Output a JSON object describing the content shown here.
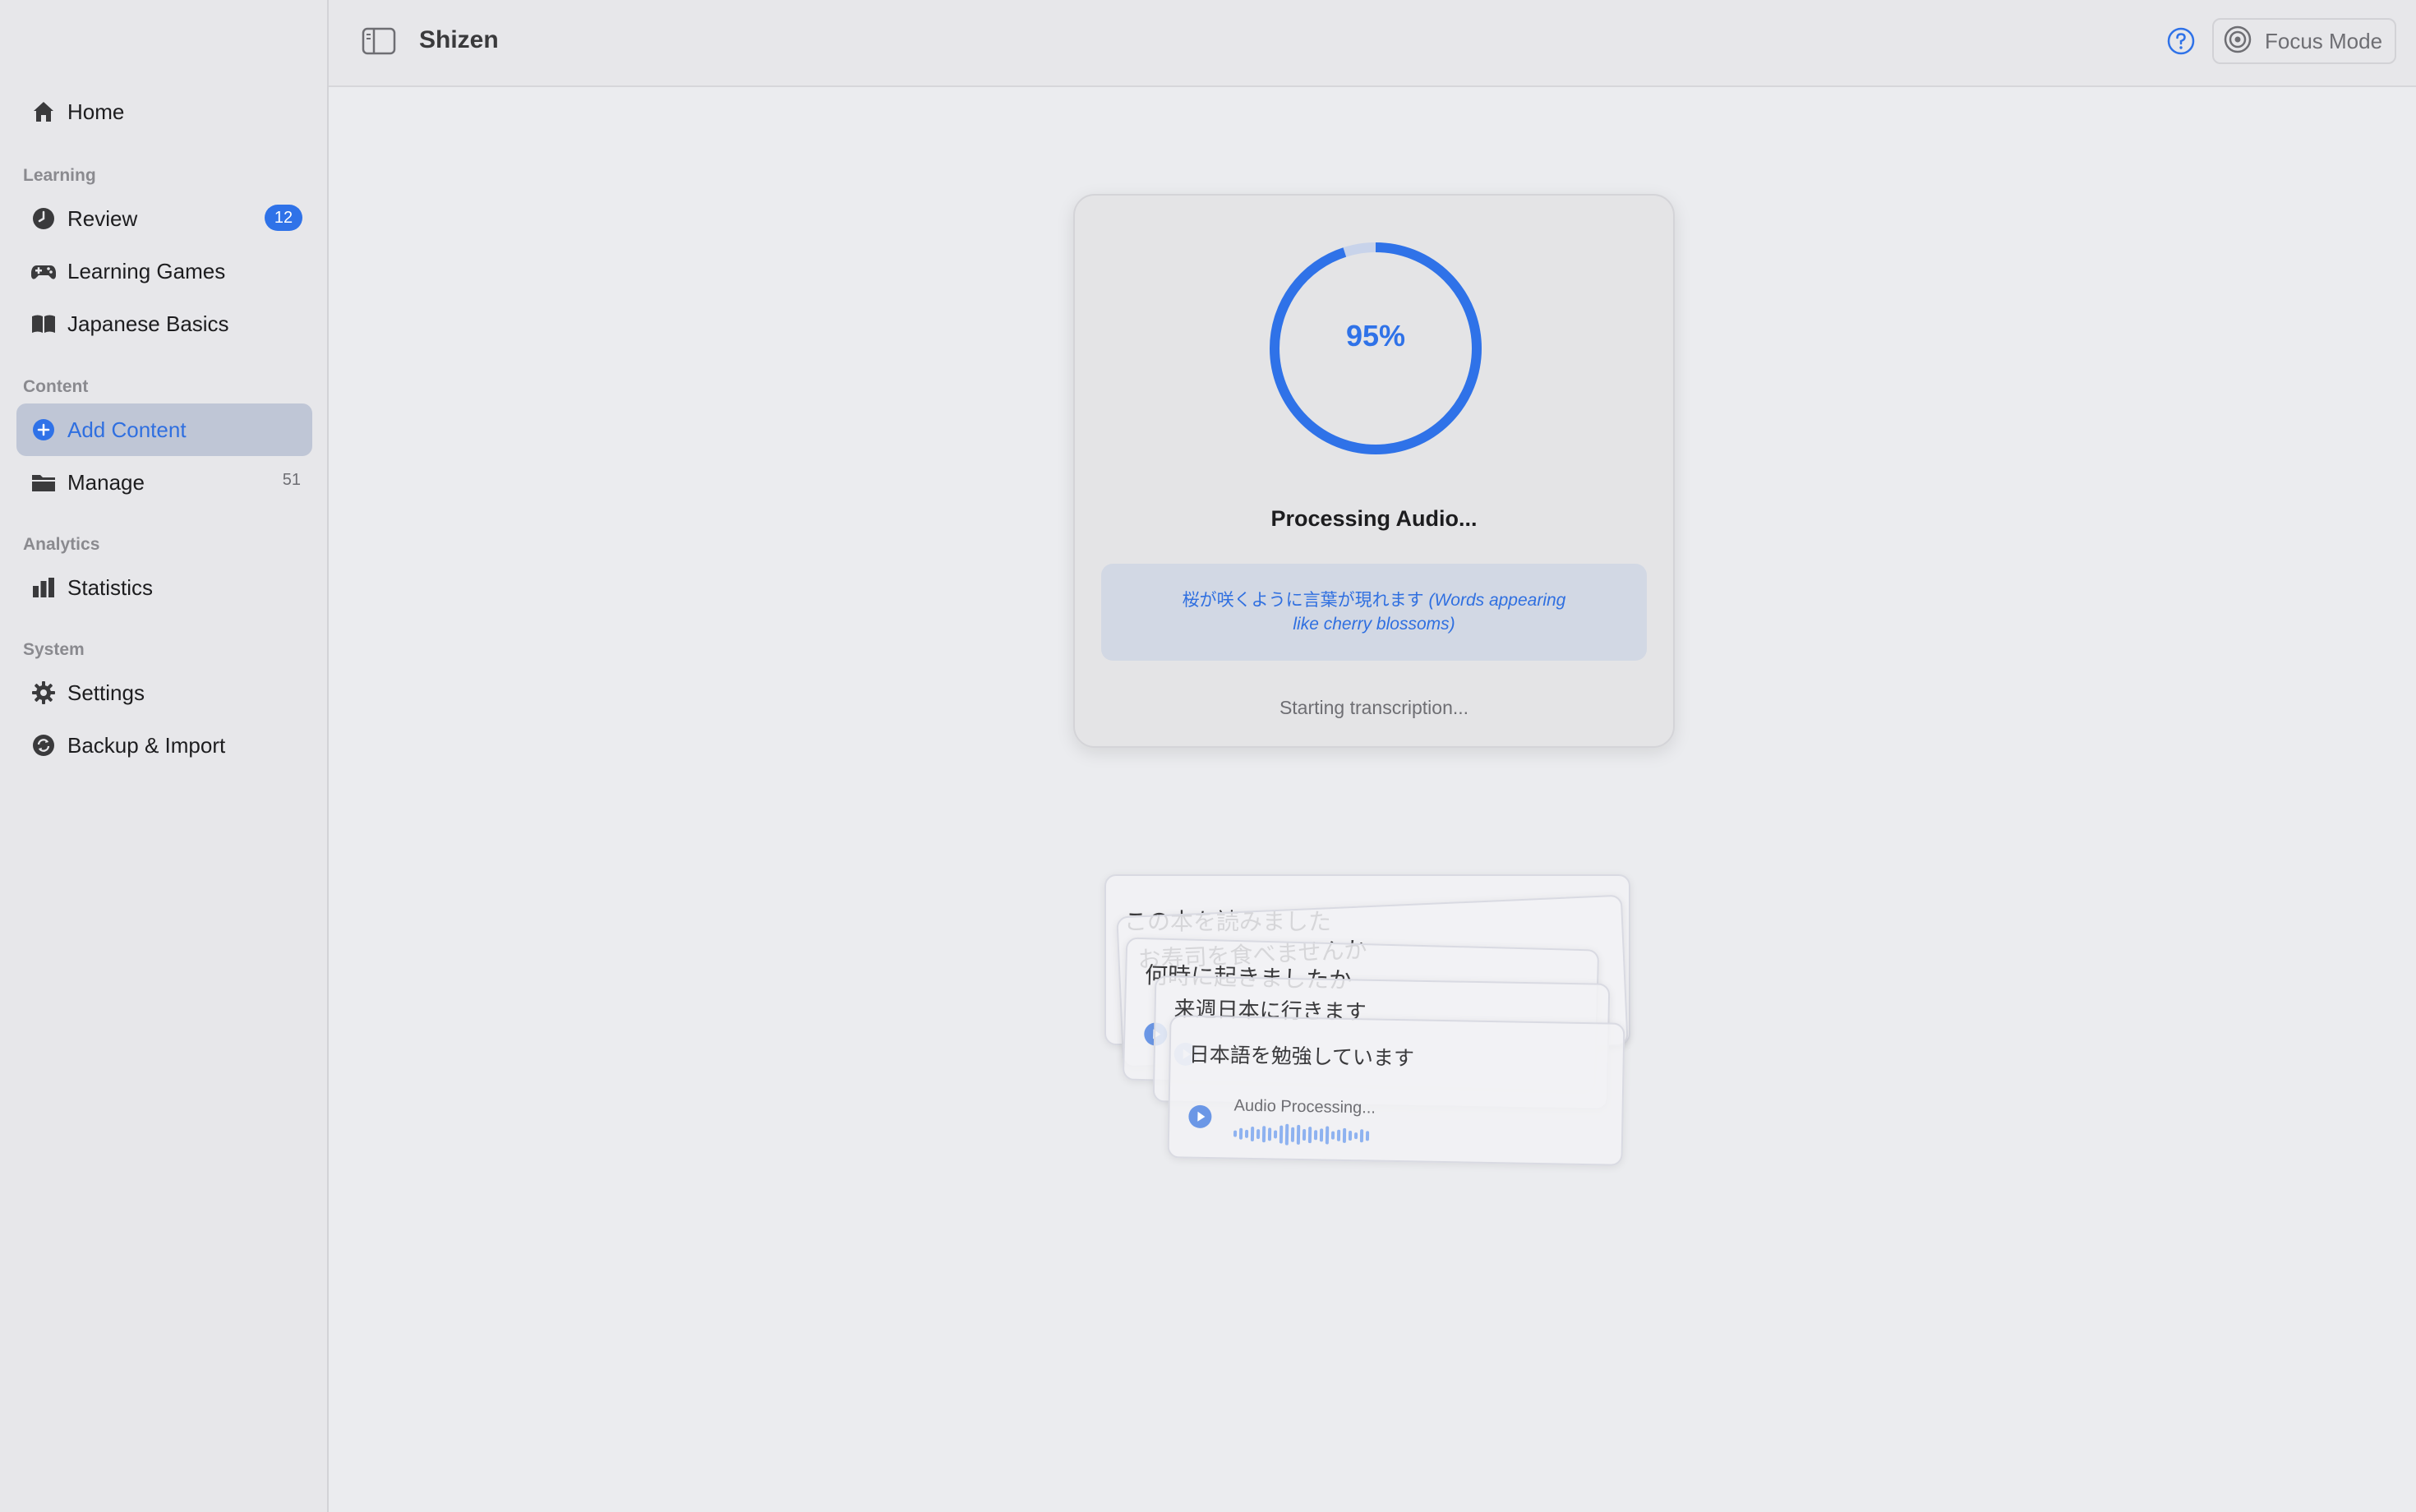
{
  "app": {
    "title": "Shizen"
  },
  "sidebar": {
    "home": {
      "label": "Home",
      "icon": "house-icon"
    },
    "sections": {
      "learning": "Learning",
      "content": "Content",
      "analytics": "Analytics",
      "system": "System"
    },
    "items": {
      "review": {
        "label": "Review",
        "badge": "12",
        "icon": "clock-icon"
      },
      "learning_games": {
        "label": "Learning Games",
        "icon": "gamepad-icon"
      },
      "japanese_basics": {
        "label": "Japanese Basics",
        "icon": "book-icon"
      },
      "add_content": {
        "label": "Add Content",
        "icon": "plus-circle-icon",
        "active": true
      },
      "manage": {
        "label": "Manage",
        "count": "51",
        "icon": "folder-icon"
      },
      "statistics": {
        "label": "Statistics",
        "icon": "bar-chart-icon"
      },
      "settings": {
        "label": "Settings",
        "icon": "gear-icon"
      },
      "backup_import": {
        "label": "Backup & Import",
        "icon": "sync-icon"
      }
    }
  },
  "toolbar": {
    "focus_mode_label": "Focus Mode",
    "help_icon": "question-circle-icon",
    "focus_icon": "target-icon"
  },
  "processing": {
    "progress_percent": 95,
    "progress_label": "95%",
    "title": "Processing Audio...",
    "message_jp": "桜が咲くように言葉が現れます",
    "message_en": "(Words appearing like cherry blossoms)",
    "status": "Starting transcription..."
  },
  "preview_cards": [
    {
      "text": "この本を読みました"
    },
    {
      "text": "お寿司を食べませんか"
    },
    {
      "text": "何時に起きましたか"
    },
    {
      "text": "来週日本に行きます"
    },
    {
      "text": "日本語を勉強しています",
      "audio_label": "Audio Processing..."
    }
  ],
  "colors": {
    "accent": "#2f72e8",
    "sidebar_bg": "#e7e7ea",
    "main_bg": "#ebecef",
    "active_item_bg": "#bfc6d6"
  }
}
